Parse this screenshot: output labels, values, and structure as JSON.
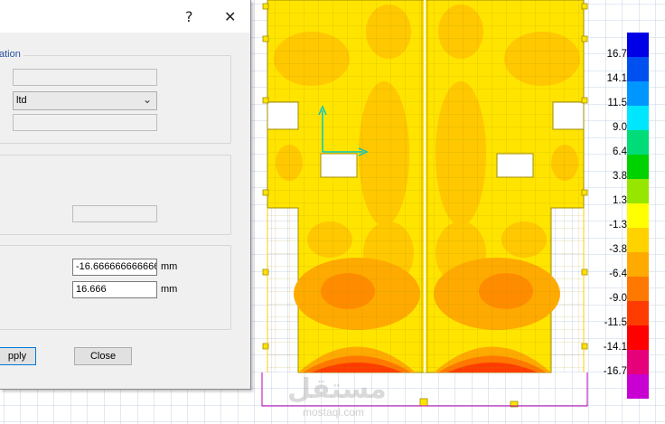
{
  "dialog": {
    "help_glyph": "?",
    "close_glyph": "✕",
    "group1_label": "ation",
    "select_value": "ltd",
    "min_value": "-16.6666666666666",
    "max_value": "16.666",
    "unit_min": "mm",
    "unit_max": "mm",
    "apply_label": "pply",
    "close_label": "Close"
  },
  "legend": {
    "labels": [
      "16.7",
      "14.1",
      "11.5",
      "9.0",
      "6.4",
      "3.8",
      "1.3",
      "-1.3",
      "-3.8",
      "-6.4",
      "-9.0",
      "-11.5",
      "-14.1",
      "-16.7"
    ],
    "colors": [
      "#0000e6",
      "#0050f0",
      "#0096ff",
      "#00e6ff",
      "#00dc78",
      "#00d200",
      "#96e600",
      "#ffff00",
      "#ffd200",
      "#ffaa00",
      "#ff7800",
      "#ff3c00",
      "#ff0000",
      "#e6007a",
      "#c800d2"
    ]
  },
  "watermark": {
    "arabic": "مستقل",
    "latin": "mostaql.com"
  }
}
